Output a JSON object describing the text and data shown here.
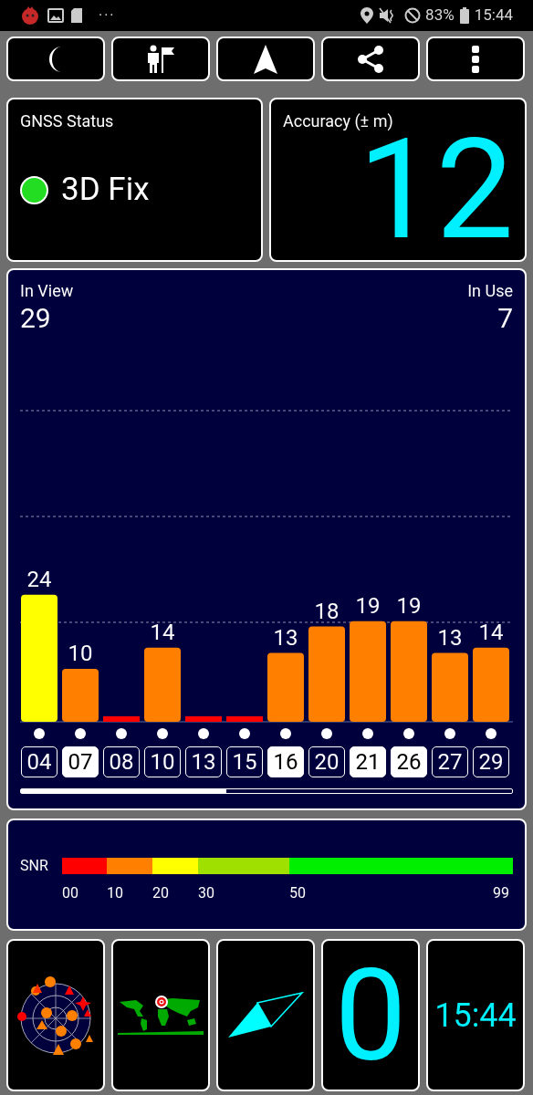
{
  "status_bar": {
    "more": "···",
    "battery": "83%",
    "time": "15:44"
  },
  "toolbar": {
    "buttons": [
      {
        "kind": "moon"
      },
      {
        "kind": "person-flag"
      },
      {
        "kind": "arrow"
      },
      {
        "kind": "share"
      },
      {
        "kind": "more"
      }
    ]
  },
  "gnss_status": {
    "title": "GNSS Status",
    "fix": "3D Fix",
    "color": "#22dd22"
  },
  "accuracy": {
    "title": "Accuracy (± m)",
    "value": "12"
  },
  "satellites": {
    "in_view_label": "In View",
    "in_view": "29",
    "in_use_label": "In Use",
    "in_use": "7",
    "used_in_fix": [
      false,
      true,
      false,
      false,
      false,
      false,
      true,
      false,
      true,
      true,
      false,
      false
    ],
    "chart_data": {
      "type": "bar",
      "categories": [
        "04",
        "07",
        "08",
        "10",
        "13",
        "15",
        "16",
        "20",
        "21",
        "26",
        "27",
        "29"
      ],
      "values": [
        24,
        10,
        0,
        14,
        0,
        0,
        13,
        18,
        19,
        19,
        13,
        14
      ],
      "value_labels": [
        "24",
        "10",
        null,
        "14",
        null,
        null,
        "13",
        "18",
        "19",
        "19",
        "13",
        "14"
      ]
    }
  },
  "snr": {
    "label": "SNR",
    "segments": [
      {
        "color": "#ff0000"
      },
      {
        "color": "#ff8000"
      },
      {
        "color": "#ffff00"
      },
      {
        "color": "#a0e000"
      },
      {
        "color": "#00ee00"
      }
    ],
    "ticks": [
      "00",
      "10",
      "20",
      "30",
      "50",
      "99"
    ]
  },
  "tiles": [
    {
      "kind": "skyplot"
    },
    {
      "kind": "worldmap"
    },
    {
      "kind": "compass"
    },
    {
      "kind": "number",
      "text": "0"
    },
    {
      "kind": "clock",
      "text": "15:44"
    }
  ]
}
